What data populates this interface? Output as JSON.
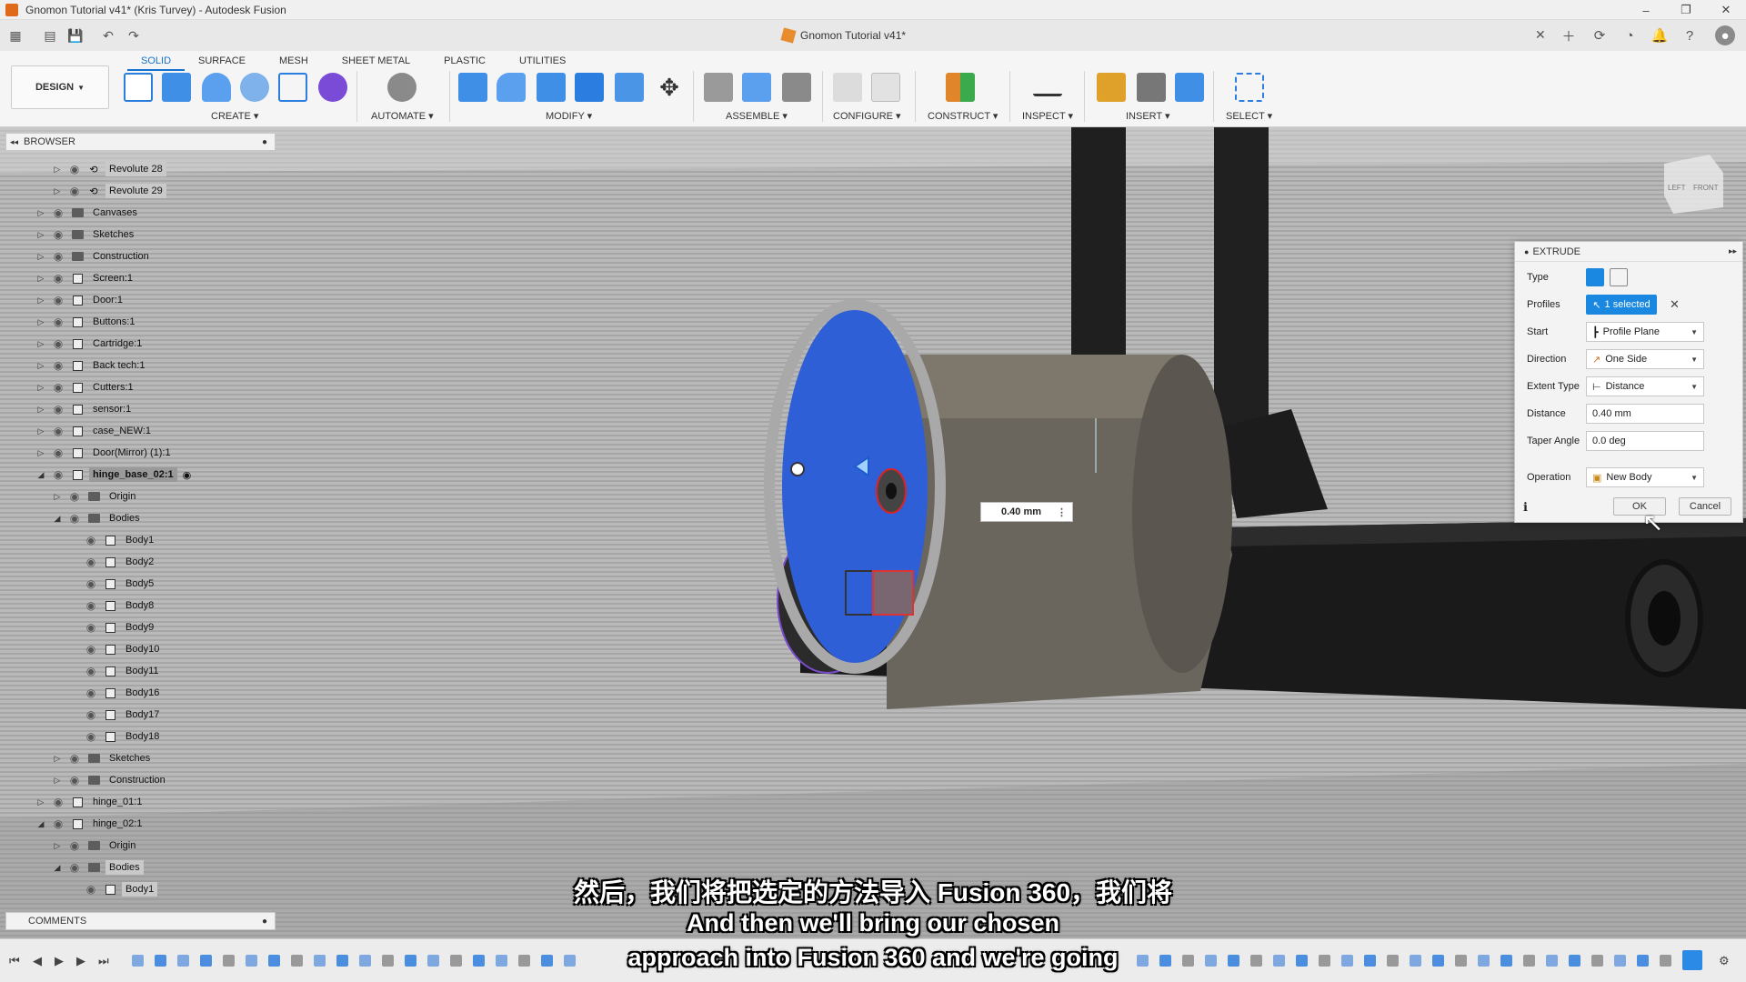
{
  "window": {
    "title": "Gnomon Tutorial v41* (Kris Turvey) - Autodesk Fusion",
    "doc_tab": "Gnomon Tutorial v41*"
  },
  "ribbon": {
    "tabs": [
      "SOLID",
      "SURFACE",
      "MESH",
      "SHEET METAL",
      "PLASTIC",
      "UTILITIES"
    ],
    "active_tab": "SOLID",
    "design_label": "DESIGN",
    "groups": [
      "CREATE",
      "AUTOMATE",
      "MODIFY",
      "ASSEMBLE",
      "CONFIGURE",
      "CONSTRUCT",
      "INSPECT",
      "INSERT",
      "SELECT"
    ]
  },
  "browser": {
    "title": "BROWSER",
    "items": [
      {
        "label": "Revolute 28"
      },
      {
        "label": "Revolute 29"
      },
      {
        "label": "Canvases"
      },
      {
        "label": "Sketches"
      },
      {
        "label": "Construction"
      },
      {
        "label": "Screen:1"
      },
      {
        "label": "Door:1"
      },
      {
        "label": "Buttons:1"
      },
      {
        "label": "Cartridge:1"
      },
      {
        "label": "Back tech:1"
      },
      {
        "label": "Cutters:1"
      },
      {
        "label": "sensor:1"
      },
      {
        "label": "case_NEW:1"
      },
      {
        "label": "Door(Mirror) (1):1"
      },
      {
        "label": "hinge_base_02:1"
      },
      {
        "label": "Origin"
      },
      {
        "label": "Bodies"
      },
      {
        "label": "Body1"
      },
      {
        "label": "Body2"
      },
      {
        "label": "Body5"
      },
      {
        "label": "Body8"
      },
      {
        "label": "Body9"
      },
      {
        "label": "Body10"
      },
      {
        "label": "Body11"
      },
      {
        "label": "Body16"
      },
      {
        "label": "Body17"
      },
      {
        "label": "Body18"
      },
      {
        "label": "Sketches"
      },
      {
        "label": "Construction"
      },
      {
        "label": "hinge_01:1"
      },
      {
        "label": "hinge_02:1"
      },
      {
        "label": "Origin"
      },
      {
        "label": "Bodies"
      },
      {
        "label": "Body1"
      }
    ]
  },
  "comments": {
    "title": "COMMENTS"
  },
  "extrude": {
    "title": "EXTRUDE",
    "type_label": "Type",
    "profiles_label": "Profiles",
    "profiles_value": "1 selected",
    "start_label": "Start",
    "start_value": "Profile Plane",
    "direction_label": "Direction",
    "direction_value": "One Side",
    "extent_label": "Extent Type",
    "extent_value": "Distance",
    "distance_label": "Distance",
    "distance_value": "0.40 mm",
    "taper_label": "Taper Angle",
    "taper_value": "0.0 deg",
    "operation_label": "Operation",
    "operation_value": "New Body",
    "ok_label": "OK",
    "cancel_label": "Cancel"
  },
  "viewport": {
    "dimension_value": "0.40 mm",
    "viewcube_left": "LEFT",
    "viewcube_front": "FRONT",
    "accent_color": "#2f5fd6"
  },
  "subtitles": {
    "zh": "然后，我们将把选定的方法导入 Fusion 360，我们将",
    "en_line1": "And then we'll bring our chosen",
    "en_line2": "approach into Fusion 360 and we're going"
  }
}
